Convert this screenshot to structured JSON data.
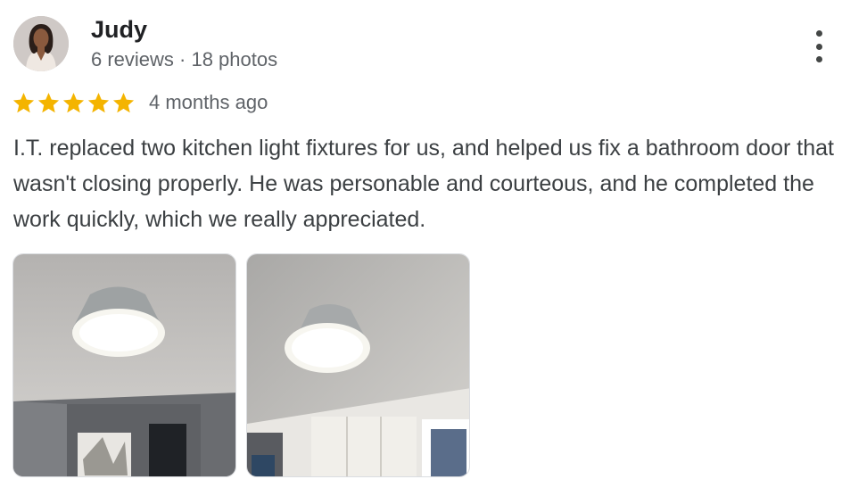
{
  "reviewer": {
    "name": "Judy",
    "meta": "6 reviews · 18 photos",
    "avatar_icon": "profile-photo"
  },
  "review": {
    "rating": 5,
    "max_rating": 5,
    "date": "4 months ago",
    "text": "I.T. replaced two kitchen light fixtures for us, and helped us fix a bathroom door that wasn't closing properly. He was personable and courteous, and he completed the work quickly, which we really appreciated."
  },
  "menu_icon": "more-vert-icon",
  "colors": {
    "star": "#f4b400",
    "name": "#202124",
    "meta": "#5f6368",
    "body_text": "#3c4043"
  }
}
